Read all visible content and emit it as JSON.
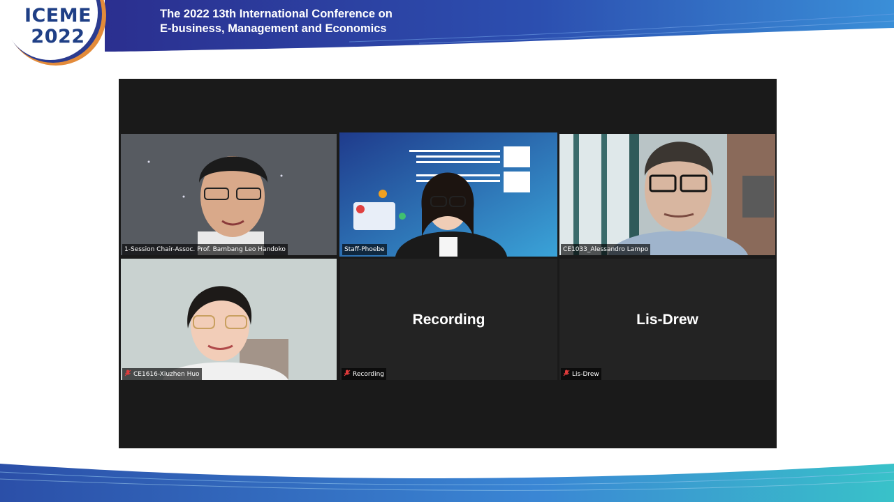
{
  "logo": {
    "line1": "ICEME",
    "line2": "2022"
  },
  "conference": {
    "title_line1": "The 2022 13th International Conference on",
    "title_line2": "E-business, Management and Economics"
  },
  "participants": [
    {
      "label": "1-Session Chair-Assoc. Prof. Bambang Leo Handoko",
      "muted": false,
      "video": true
    },
    {
      "label": "Staff-Phoebe",
      "muted": false,
      "video": true,
      "active": true
    },
    {
      "label": "CE1033_Alessandro Lampo",
      "muted": false,
      "video": true
    },
    {
      "label": "CE1616-Xiuzhen Huo",
      "muted": true,
      "video": true
    },
    {
      "label": "Recording",
      "display_name": "Recording",
      "muted": true,
      "video": false
    },
    {
      "label": "Lis-Drew",
      "display_name": "Lis-Drew",
      "muted": true,
      "video": false
    }
  ],
  "colors": {
    "banner": "#2a3c9a",
    "accent_orange": "#e38b3a",
    "active_border": "#e6f36b",
    "muted_icon": "#e03b3b"
  }
}
